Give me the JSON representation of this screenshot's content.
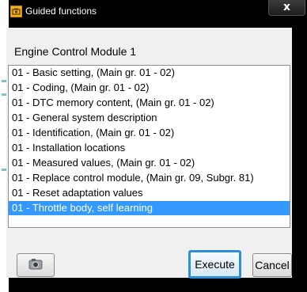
{
  "window": {
    "title": "Guided functions",
    "close_label": "x",
    "module_title": "Engine Control Module 1"
  },
  "list": {
    "items": [
      "01 - Basic setting, (Main gr. 01 - 02)",
      "01 - Coding, (Main gr. 01 - 02)",
      "01 - DTC memory content, (Main gr. 01 - 02)",
      "01 - General system description",
      "01 - Identification, (Main gr. 01 - 02)",
      "01 - Installation locations",
      "01 - Measured values, (Main gr. 01 - 02)",
      "01 - Replace control module, (Main gr. 09, Subgr. 81)",
      "01 - Reset adaptation values",
      "01 - Throttle body, self learning"
    ],
    "selected_index": 9
  },
  "buttons": {
    "camera_icon": "camera-icon",
    "execute_label": "Execute",
    "cancel_label": "Cancel"
  },
  "colors": {
    "selection": "#3399ff",
    "default_button_border": "#2b8fd9",
    "app_icon": "#f2b21a"
  }
}
